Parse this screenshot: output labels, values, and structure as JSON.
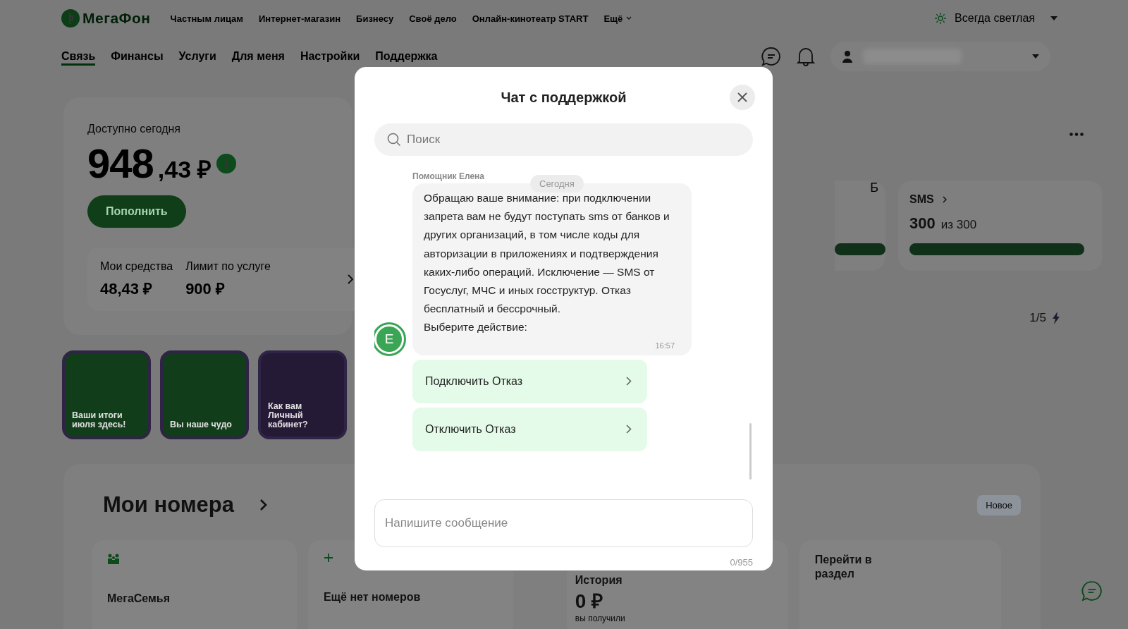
{
  "header": {
    "logo_text": "МегаФон",
    "nav": [
      "Частным лицам",
      "Интернет-магазин",
      "Бизнесу",
      "Своё дело",
      "Онлайн-кинотеатр START"
    ],
    "more": "Ещё",
    "theme": "Всегда светлая"
  },
  "tabs": [
    {
      "label": "Связь",
      "selected": true
    },
    {
      "label": "Финансы",
      "selected": false
    },
    {
      "label": "Услуги",
      "selected": false
    },
    {
      "label": "Для меня",
      "selected": false
    },
    {
      "label": "Настройки",
      "selected": false
    },
    {
      "label": "Поддержка",
      "selected": false
    }
  ],
  "balance": {
    "label": "Доступно сегодня",
    "amount_main": "948",
    "amount_fraction": ",43 ₽",
    "top_up": "Пополнить",
    "funds": [
      {
        "label": "Мои средства",
        "value": "48,43 ₽"
      },
      {
        "label": "Лимит по услуге",
        "value": "900 ₽"
      }
    ]
  },
  "stories": [
    {
      "title": "Ваши итоги июля здесь!",
      "color": "#123d1a"
    },
    {
      "title": "Вы наше чудо",
      "color": "#123d1a"
    },
    {
      "title": "Как вам Личный кабинет?",
      "color": "#251a36"
    }
  ],
  "packages": {
    "partial": {
      "unit": "Б",
      "level": 1
    },
    "sms": {
      "title": "SMS",
      "value": "300",
      "total": "из 300",
      "level": 1
    },
    "pager": "1/5"
  },
  "numbers": {
    "title": "Мои номера",
    "badge": "Новое",
    "cards": [
      {
        "kind": "family",
        "label": "МегаСемья"
      },
      {
        "kind": "add",
        "label": "Ещё нет номеров"
      }
    ]
  },
  "history": {
    "title": "История",
    "amount": "0 ₽",
    "caption": "вы получили"
  },
  "goto": {
    "label": "Перейти в раздел"
  },
  "chat": {
    "title": "Чат с поддержкой",
    "search_placeholder": "Поиск",
    "sender": "Помощник Елена",
    "date": "Сегодня",
    "avatar": "Е",
    "message": "Обращаю ваше внимание: при подключении запрета вам не будут поступать sms от банков и других организаций, в том числе коды для авторизации в приложениях и подтверждения каких-либо операций. Исключение — SMS от Госуслуг, МЧС и иных госструктур. Отказ бесплатный и бессрочный.\nВыберите действие:",
    "time": "16:57",
    "actions": [
      "Подключить Отказ",
      "Отключить Отказ"
    ],
    "input_placeholder": "Напишите сообщение",
    "counter": "0/955"
  }
}
